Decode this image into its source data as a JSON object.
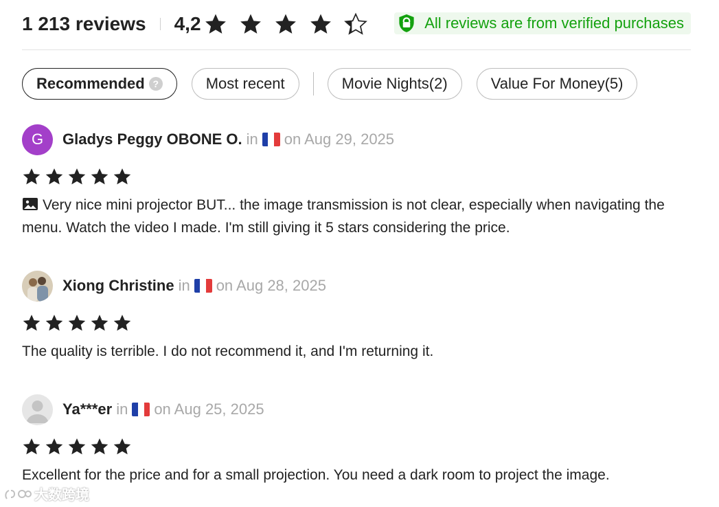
{
  "summary": {
    "review_count": "1 213 reviews",
    "rating": "4,2",
    "stars_filled": 4,
    "verified_text": "All reviews are from verified purchases"
  },
  "tabs": [
    {
      "label": "Recommended",
      "active": true,
      "help_icon": "?"
    },
    {
      "label": "Most recent"
    },
    {
      "label": "Movie Nights(2)"
    },
    {
      "label": "Value For Money(5)"
    }
  ],
  "reviews": [
    {
      "avatar_letter": "G",
      "name": "Gladys Peggy OBONE O.",
      "in": "in",
      "date": "on Aug 29, 2025",
      "stars": 5,
      "text": "Very nice mini projector BUT... the image transmission is not clear, especially when navigating the menu. Watch the video I made. I'm still giving it 5 stars considering the price."
    },
    {
      "name": "Xiong Christine",
      "in": "in",
      "date": "on Aug 28, 2025",
      "stars": 5,
      "text": "The quality is terrible. I do not recommend it, and I'm returning it."
    },
    {
      "name": "Ya***er",
      "in": "in",
      "date": "on Aug 25, 2025",
      "stars": 5,
      "text": "Excellent for the price and for a small projection. You need a dark room to project the image."
    }
  ],
  "watermark": "大数跨境",
  "colors": {
    "verified_green": "#13a10e",
    "verified_bg": "#eef8ed",
    "avatar_purple": "#a33fc9",
    "star": "#222222",
    "muted": "#a8a8a8"
  }
}
